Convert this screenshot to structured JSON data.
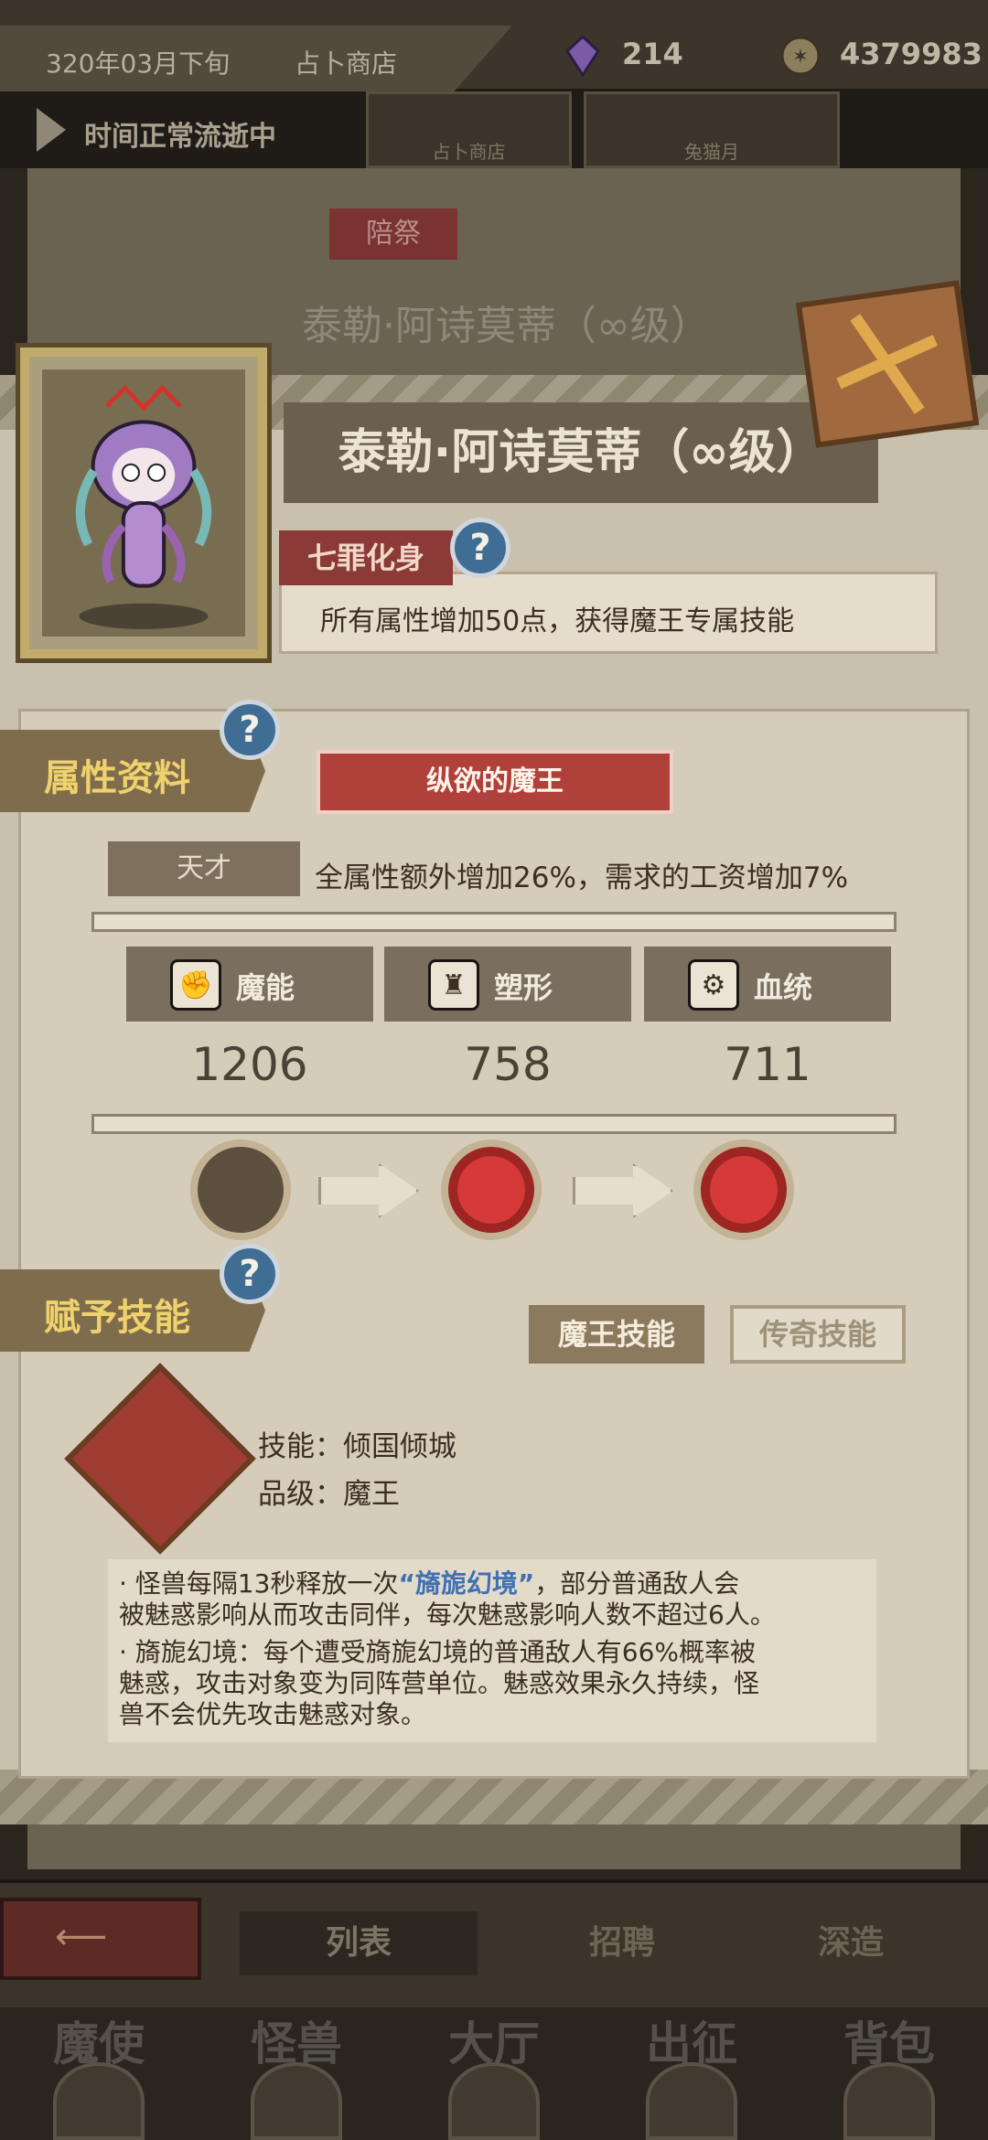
{
  "topbar": {
    "date": "320年03月下旬",
    "location": "占卜商店",
    "crystals": "214",
    "gold": "4379983"
  },
  "timebar": {
    "status": "时间正常流逝中",
    "shops": [
      "占卜商店",
      "兔猫月"
    ]
  },
  "background_card": {
    "tag": "陪祭",
    "title": "泰勒·阿诗莫蒂（∞级）"
  },
  "character": {
    "name": "泰勒·阿诗莫蒂（∞级）",
    "sin_tag": "七罪化身",
    "sin_desc": "所有属性增加50点，获得魔王专属技能"
  },
  "attributes": {
    "section_label": "属性资料",
    "ribbon": "纵欲的魔王",
    "trait_label": "天才",
    "trait_desc": "全属性额外增加26%，需求的工资增加7%",
    "stats": [
      {
        "label": "魔能",
        "value": "1206",
        "icon": "magic-claw-icon"
      },
      {
        "label": "塑形",
        "value": "758",
        "icon": "muscle-body-icon"
      },
      {
        "label": "血统",
        "value": "711",
        "icon": "gear-blood-icon"
      }
    ]
  },
  "skills": {
    "section_label": "赋予技能",
    "tabs": [
      "魔王技能",
      "传奇技能"
    ],
    "active_tab": 0,
    "skill_line": "技能：倾国倾城",
    "grade_line": "品级：魔王",
    "desc1_pre": "·    怪兽每隔13秒释放一次",
    "desc1_hl": "“旖旎幻境”",
    "desc1_post": "，部分普通敌人会",
    "desc2": "被魅惑影响从而攻击同伴，每次魅惑影响人数不超过6人。",
    "desc3": "·    旖旎幻境：每个遭受旖旎幻境的普通敌人有66%概率被",
    "desc4": "魅惑，攻击对象变为同阵营单位。魅惑效果永久持续，怪",
    "desc5": "兽不会优先攻击魅惑对象。"
  },
  "subnav": {
    "tabs": [
      "列表",
      "招聘",
      "深造"
    ],
    "active": 0
  },
  "bottom_nav": [
    "魔使",
    "怪兽",
    "大厅",
    "出征",
    "背包"
  ],
  "colors": {
    "accent_red": "#b0403a",
    "panel": "#d5ccb9",
    "highlight_blue": "#4170b3",
    "gold_text": "#f0d26d"
  }
}
